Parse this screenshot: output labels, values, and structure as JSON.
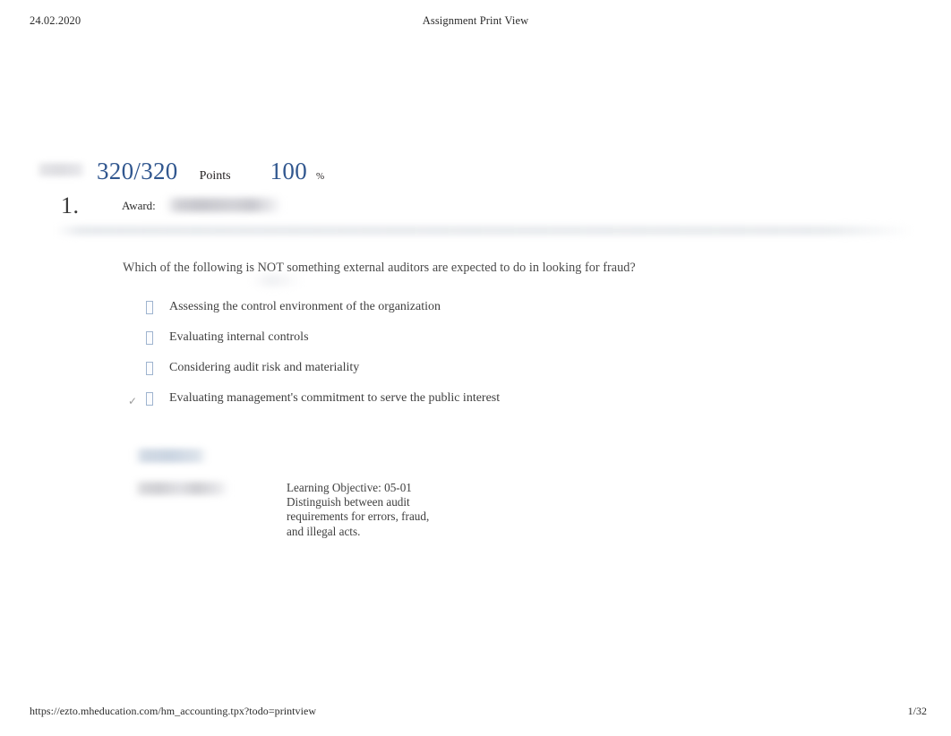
{
  "page": {
    "header": {
      "date": "24.02.2020",
      "title": "Assignment Print View"
    },
    "score": {
      "label_redacted": "",
      "fraction": "320/320",
      "points_label": "Points",
      "percent": "100",
      "percent_sign": "%",
      "accent_color": "#31578f"
    },
    "question": {
      "number": "1.",
      "award_label": "Award:",
      "award_value_redacted": "",
      "prompt": "Which of the following is  NOT something external auditors are expected to do in looking for fraud?",
      "options": [
        {
          "label": "Assessing the control environment of the organization",
          "selected": false,
          "marker": "checkbox-glyph"
        },
        {
          "label": "Evaluating internal controls",
          "selected": false,
          "marker": "checkbox-glyph"
        },
        {
          "label": "Considering audit risk and materiality",
          "selected": false,
          "marker": "checkbox-glyph"
        },
        {
          "label": "Evaluating management's commitment to serve the public interest",
          "selected": true,
          "marker": "checkbox-glyph",
          "check_symbol": "✓"
        }
      ]
    },
    "metadata": {
      "redacted_link": "",
      "redacted_text": "",
      "learning_objective": "Learning Objective: 05-01 Distinguish between audit requirements for errors, fraud, and illegal acts."
    },
    "footer": {
      "url": "https://ezto.mheducation.com/hm_accounting.tpx?todo=printview",
      "page_indicator": "1/32"
    }
  }
}
